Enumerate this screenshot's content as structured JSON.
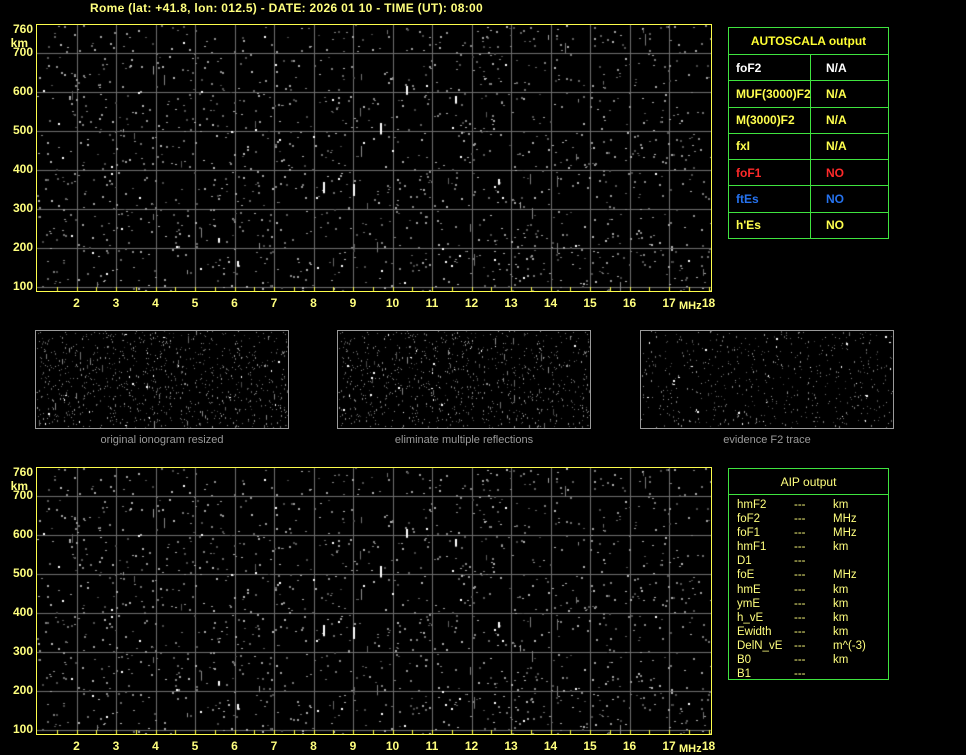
{
  "title": "Rome (lat: +41.8, lon: 012.5) - DATE: 2026 01 10 - TIME (UT): 08:00",
  "colors": {
    "background": "#000000",
    "label_yellow": "#ffff7e",
    "frame_yellow": "#fdfd4b",
    "table_border_green": "#3fe43f",
    "grid_gray": "#6f6f6f",
    "caption_gray": "#9a9a9a",
    "status_white": "#ffffff",
    "status_yellow": "#ffff4e",
    "status_red": "#ff2a2a",
    "status_blue": "#2673f0"
  },
  "ionogram": {
    "y_unit": "km",
    "x_unit": "MHz",
    "y_ticks": [
      "760",
      "700",
      "600",
      "500",
      "400",
      "300",
      "200",
      "100"
    ],
    "x_ticks": [
      "2",
      "3",
      "4",
      "5",
      "6",
      "7",
      "8",
      "9",
      "10",
      "11",
      "12",
      "13",
      "14",
      "15",
      "16",
      "17",
      "18"
    ],
    "x_range": [
      1,
      18.1
    ],
    "y_range": [
      66,
      760
    ],
    "grid": "on"
  },
  "autoscala_table": {
    "title": "AUTOSCALA output",
    "rows": [
      {
        "label": "foF2",
        "value": "N/A",
        "color": "#ffffff"
      },
      {
        "label": "MUF(3000)F2",
        "value": "N/A",
        "color": "#ffff4e"
      },
      {
        "label": "M(3000)F2",
        "value": "N/A",
        "color": "#ffff4e"
      },
      {
        "label": "fxI",
        "value": "N/A",
        "color": "#ffff4e"
      },
      {
        "label": "foF1",
        "value": "NO",
        "color": "#ff2a2a"
      },
      {
        "label": "ftEs",
        "value": "NO",
        "color": "#2673f0"
      },
      {
        "label": "h'Es",
        "value": "NO",
        "color": "#ffff4e"
      }
    ]
  },
  "thumbnails": [
    {
      "caption": "original ionogram resized"
    },
    {
      "caption": "eliminate multiple reflections"
    },
    {
      "caption": "evidence F2 trace"
    }
  ],
  "aip_table": {
    "title": "AIP output",
    "rows": [
      {
        "label": "hmF2",
        "value": "---",
        "unit": "km"
      },
      {
        "label": "foF2",
        "value": "---",
        "unit": "MHz"
      },
      {
        "label": "foF1",
        "value": "---",
        "unit": "MHz"
      },
      {
        "label": "hmF1",
        "value": "---",
        "unit": "km"
      },
      {
        "label": "D1",
        "value": "---",
        "unit": ""
      },
      {
        "label": "foE",
        "value": "---",
        "unit": "MHz"
      },
      {
        "label": "hmE",
        "value": "---",
        "unit": "km"
      },
      {
        "label": "ymE",
        "value": "---",
        "unit": "km"
      },
      {
        "label": "h_vE",
        "value": "---",
        "unit": "km"
      },
      {
        "label": "Ewidth",
        "value": "---",
        "unit": "km"
      },
      {
        "label": "DelN_vE",
        "value": "---",
        "unit": "m^(-3)"
      },
      {
        "label": "B0",
        "value": "---",
        "unit": "km"
      },
      {
        "label": "B1",
        "value": "---",
        "unit": ""
      }
    ]
  }
}
